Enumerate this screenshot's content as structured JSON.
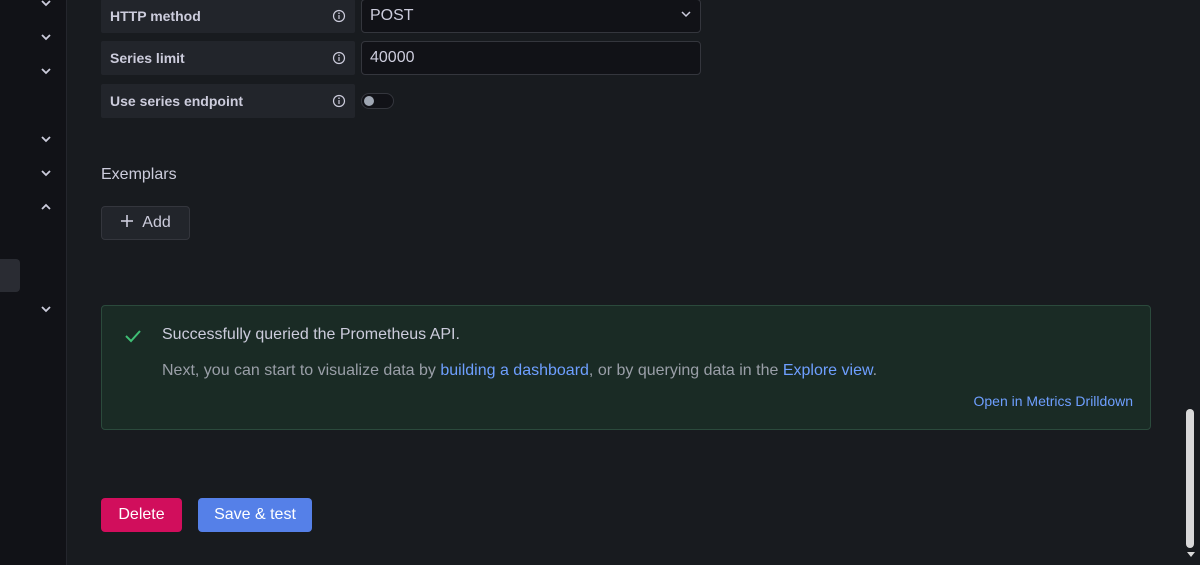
{
  "sidebar": {
    "chevrons": [
      "down",
      "down",
      "down",
      "down",
      "down",
      "up",
      "down"
    ]
  },
  "settings": {
    "http_method": {
      "label": "HTTP method",
      "value": "POST"
    },
    "series_limit": {
      "label": "Series limit",
      "value": "40000"
    },
    "use_series_endpoint": {
      "label": "Use series endpoint",
      "enabled": false
    }
  },
  "exemplars": {
    "title": "Exemplars",
    "add_label": "Add"
  },
  "alert": {
    "title": "Successfully queried the Prometheus API.",
    "body_prefix": "Next, you can start to visualize data by ",
    "link1": "building a dashboard",
    "body_middle": ", or by querying data in the ",
    "link2": "Explore view",
    "body_suffix": ".",
    "action_link": "Open in Metrics Drilldown",
    "accent_color": "#3fbf75"
  },
  "actions": {
    "delete_label": "Delete",
    "save_label": "Save & test"
  }
}
